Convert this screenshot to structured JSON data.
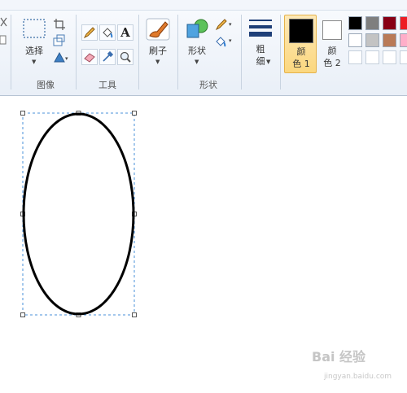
{
  "ribbon": {
    "groups": {
      "image": {
        "select_label": "选择",
        "group_label": "图像"
      },
      "tools": {
        "group_label": "工具"
      },
      "brushes": {
        "label": "刷子"
      },
      "shapes": {
        "label": "形状",
        "group_label": "形状"
      },
      "size": {
        "label_line1": "粗",
        "label_line2": "细"
      },
      "color1": {
        "label_line1": "颜",
        "label_line2": "色 1",
        "color": "#000000"
      },
      "color2": {
        "label_line1": "颜",
        "label_line2": "色 2",
        "color": "#ffffff"
      }
    },
    "palette": {
      "row1": [
        "#000000",
        "#7f7f7f",
        "#880015",
        "#ed1c24"
      ],
      "row2": [
        "#ffffff",
        "#c3c3c3",
        "#b97a57",
        "#ffaec9"
      ],
      "row3": [
        "#ffffff",
        "#ffffff",
        "#ffffff",
        "#ffffff"
      ]
    }
  },
  "canvas": {
    "shape": "ellipse",
    "selection": "dashed-rectangle"
  },
  "watermark": {
    "main": "Bai 经验",
    "sub": "jingyan.baidu.com"
  }
}
